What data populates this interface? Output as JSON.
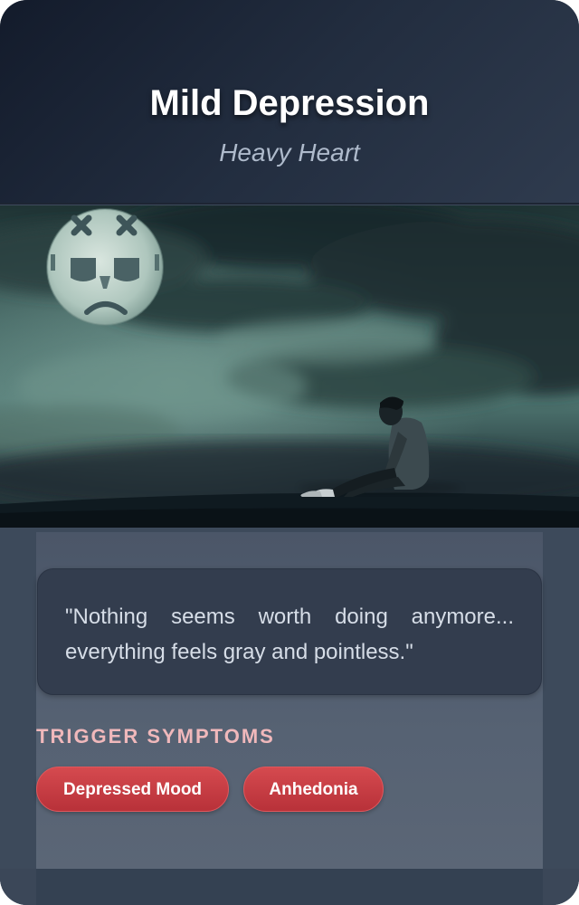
{
  "card": {
    "title": "Mild Depression",
    "subtitle": "Heavy Heart",
    "image": {
      "description_icon": "sad-moon-lonely-figure-illustration"
    },
    "quote": "\"Nothing seems worth doing anymore... everything feels gray and pointless.\"",
    "symptoms": {
      "label": "TRIGGER SYMPTOMS",
      "items": [
        {
          "label": "Depressed Mood"
        },
        {
          "label": "Anhedonia"
        }
      ]
    }
  },
  "colors": {
    "header_bg": "#1a2333",
    "chip_red": "#c73a41",
    "label_pink": "#f0b8bb",
    "body_bg": "#566273"
  }
}
